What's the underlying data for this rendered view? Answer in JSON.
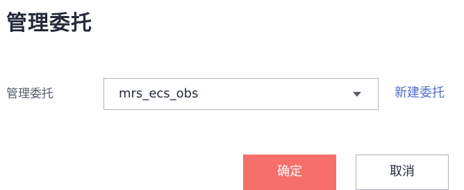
{
  "dialog": {
    "title": "管理委托",
    "field_label": "管理委托",
    "select": {
      "value": "mrs_ecs_obs"
    },
    "create_link": "新建委托",
    "confirm_label": "确定",
    "cancel_label": "取消"
  },
  "colors": {
    "primary": "#f66f6a",
    "link": "#526ecc",
    "border": "#adb0b8",
    "text": "#252b3a"
  },
  "icons": {
    "select_caret": "caret-down-icon"
  }
}
